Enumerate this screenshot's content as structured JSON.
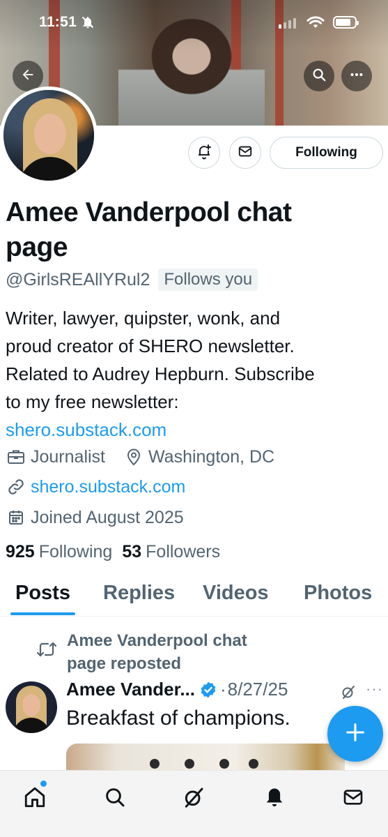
{
  "status_bar": {
    "time": "11:51"
  },
  "header": {
    "back_icon": "arrow-left-icon",
    "search_icon": "search-icon",
    "more_icon": "more-horizontal-icon"
  },
  "profile": {
    "display_name": "Amee Vanderpool chat page",
    "handle": "@GirlsREAllYRul2",
    "follows_you": "Follows you",
    "bio_lines": [
      "Writer, lawyer, quipster, wonk, and",
      "proud creator of SHERO newsletter.",
      "Related to Audrey Hepburn. Subscribe",
      "to my free newsletter:"
    ],
    "bio_link": "shero.substack.com",
    "profession": "Journalist",
    "location": "Washington, DC",
    "website": "shero.substack.com",
    "joined": "Joined August 2025",
    "following_count": "925",
    "following_label": "Following",
    "followers_count": "53",
    "followers_label": "Followers"
  },
  "actions": {
    "follow_button": "Following"
  },
  "tabs": [
    {
      "label": "Posts",
      "active": true
    },
    {
      "label": "Replies",
      "active": false
    },
    {
      "label": "Videos",
      "active": false
    },
    {
      "label": "Photos",
      "active": false
    }
  ],
  "post": {
    "repost_label_line1": "Amee Vanderpool chat",
    "repost_label_line2": "page reposted",
    "author": "Amee Vander...",
    "date": "8/27/25",
    "separator": "·",
    "text": "Breakfast of champions.",
    "more": "···"
  },
  "bottom_nav": [
    {
      "name": "home-icon",
      "has_badge": true
    },
    {
      "name": "search-icon",
      "has_badge": false
    },
    {
      "name": "grok-icon",
      "has_badge": false
    },
    {
      "name": "bell-icon",
      "has_badge": false
    },
    {
      "name": "mail-icon",
      "has_badge": false
    }
  ],
  "colors": {
    "accent": "#1d9bf0",
    "text_primary": "#0f1419",
    "text_secondary": "#536471",
    "border": "#cfd9de"
  }
}
